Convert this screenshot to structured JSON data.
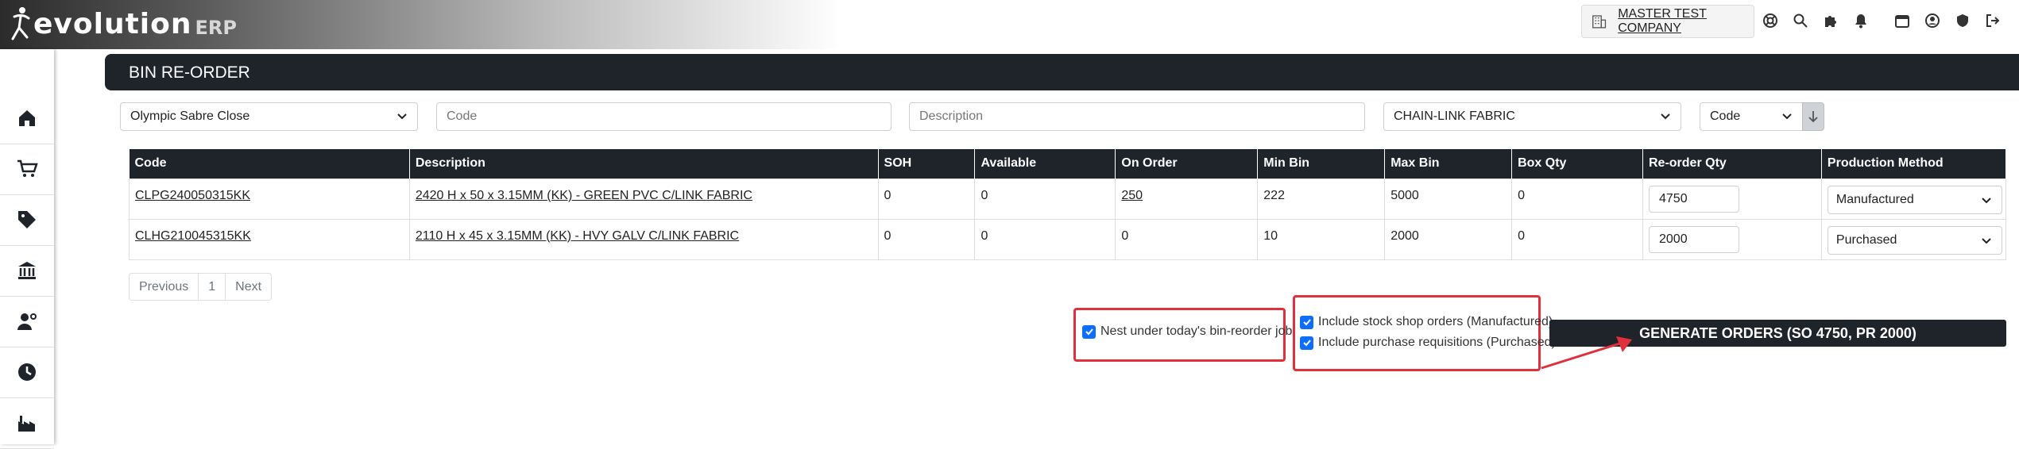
{
  "app": {
    "logo_main": "evolution",
    "logo_sub": "ERP"
  },
  "header": {
    "company": "MASTER TEST COMPANY"
  },
  "page": {
    "title": "BIN RE-ORDER"
  },
  "filters": {
    "location": "Olympic Sabre Close",
    "code_placeholder": "Code",
    "description_placeholder": "Description",
    "group": "CHAIN-LINK FABRIC",
    "sort": "Code"
  },
  "table": {
    "headers": [
      "Code",
      "Description",
      "SOH",
      "Available",
      "On Order",
      "Min Bin",
      "Max Bin",
      "Box Qty",
      "Re-order Qty",
      "Production Method"
    ],
    "rows": [
      {
        "code": "CLPG240050315KK",
        "description": "2420 H x 50 x 3.15MM (KK) - GREEN PVC C/LINK FABRIC",
        "soh": "0",
        "available": "0",
        "on_order": "250",
        "min_bin": "222",
        "max_bin": "5000",
        "box_qty": "0",
        "reorder_qty": "4750",
        "method": "Manufactured"
      },
      {
        "code": "CLHG210045315KK",
        "description": "2110 H x 45 x 3.15MM (KK) - HVY GALV C/LINK FABRIC",
        "soh": "0",
        "available": "0",
        "on_order": "0",
        "min_bin": "10",
        "max_bin": "2000",
        "box_qty": "0",
        "reorder_qty": "2000",
        "method": "Purchased"
      }
    ]
  },
  "pager": {
    "prev": "Previous",
    "page": "1",
    "next": "Next"
  },
  "options": {
    "nest": "Nest under today's bin-reorder job",
    "include_shop": "Include stock shop orders (Manufactured)",
    "include_pr": "Include purchase requisitions (Purchased)"
  },
  "actions": {
    "generate": "GENERATE ORDERS (SO 4750, PR 2000)"
  },
  "colors": {
    "accent": "#0d6efd",
    "dark": "#1f242b",
    "highlight": "#e0303c"
  }
}
